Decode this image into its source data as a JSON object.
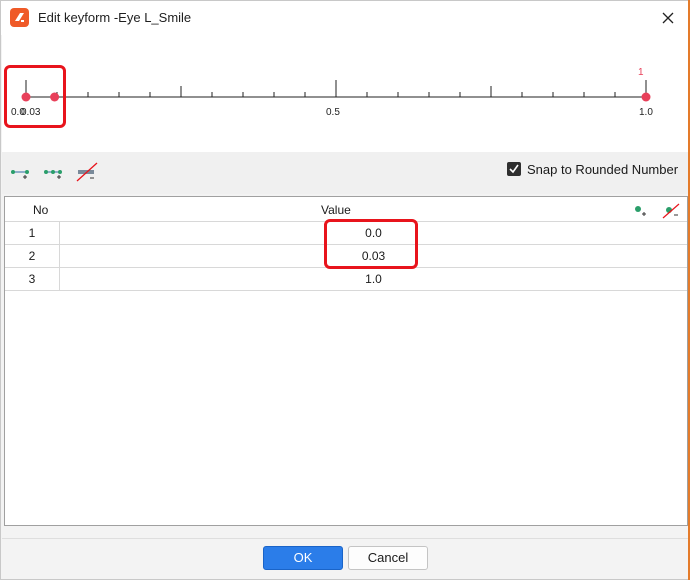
{
  "window": {
    "title": "Edit keyform -Eye L_Smile",
    "close_icon": "close-icon",
    "app_icon": "cubism-app-icon"
  },
  "ruler": {
    "min_label": "0.0",
    "point2_label": "0.03",
    "mid_label": "0.5",
    "max_label": "1.0",
    "selected_point_number": "1",
    "points": [
      0.0,
      0.03,
      1.0
    ],
    "point_color": "#e8405a"
  },
  "toolbar": {
    "add_key_icon": "add-key-icon",
    "add_keys_icon": "add-multiple-keys-icon",
    "delete_key_icon": "delete-key-icon",
    "snap_label": "Snap to Rounded Number",
    "snap_checked": true
  },
  "table": {
    "col_no": "No",
    "col_value": "Value",
    "rows": [
      {
        "no": "1",
        "value": "0.0"
      },
      {
        "no": "2",
        "value": "0.03"
      },
      {
        "no": "3",
        "value": "1.0"
      }
    ],
    "add_row_icon": "add-row-icon",
    "remove_row_icon": "remove-row-icon"
  },
  "footer": {
    "ok_label": "OK",
    "cancel_label": "Cancel"
  },
  "colors": {
    "accent": "#2b7de9",
    "highlight": "#e8141c",
    "app_icon": "#ef5a28"
  }
}
